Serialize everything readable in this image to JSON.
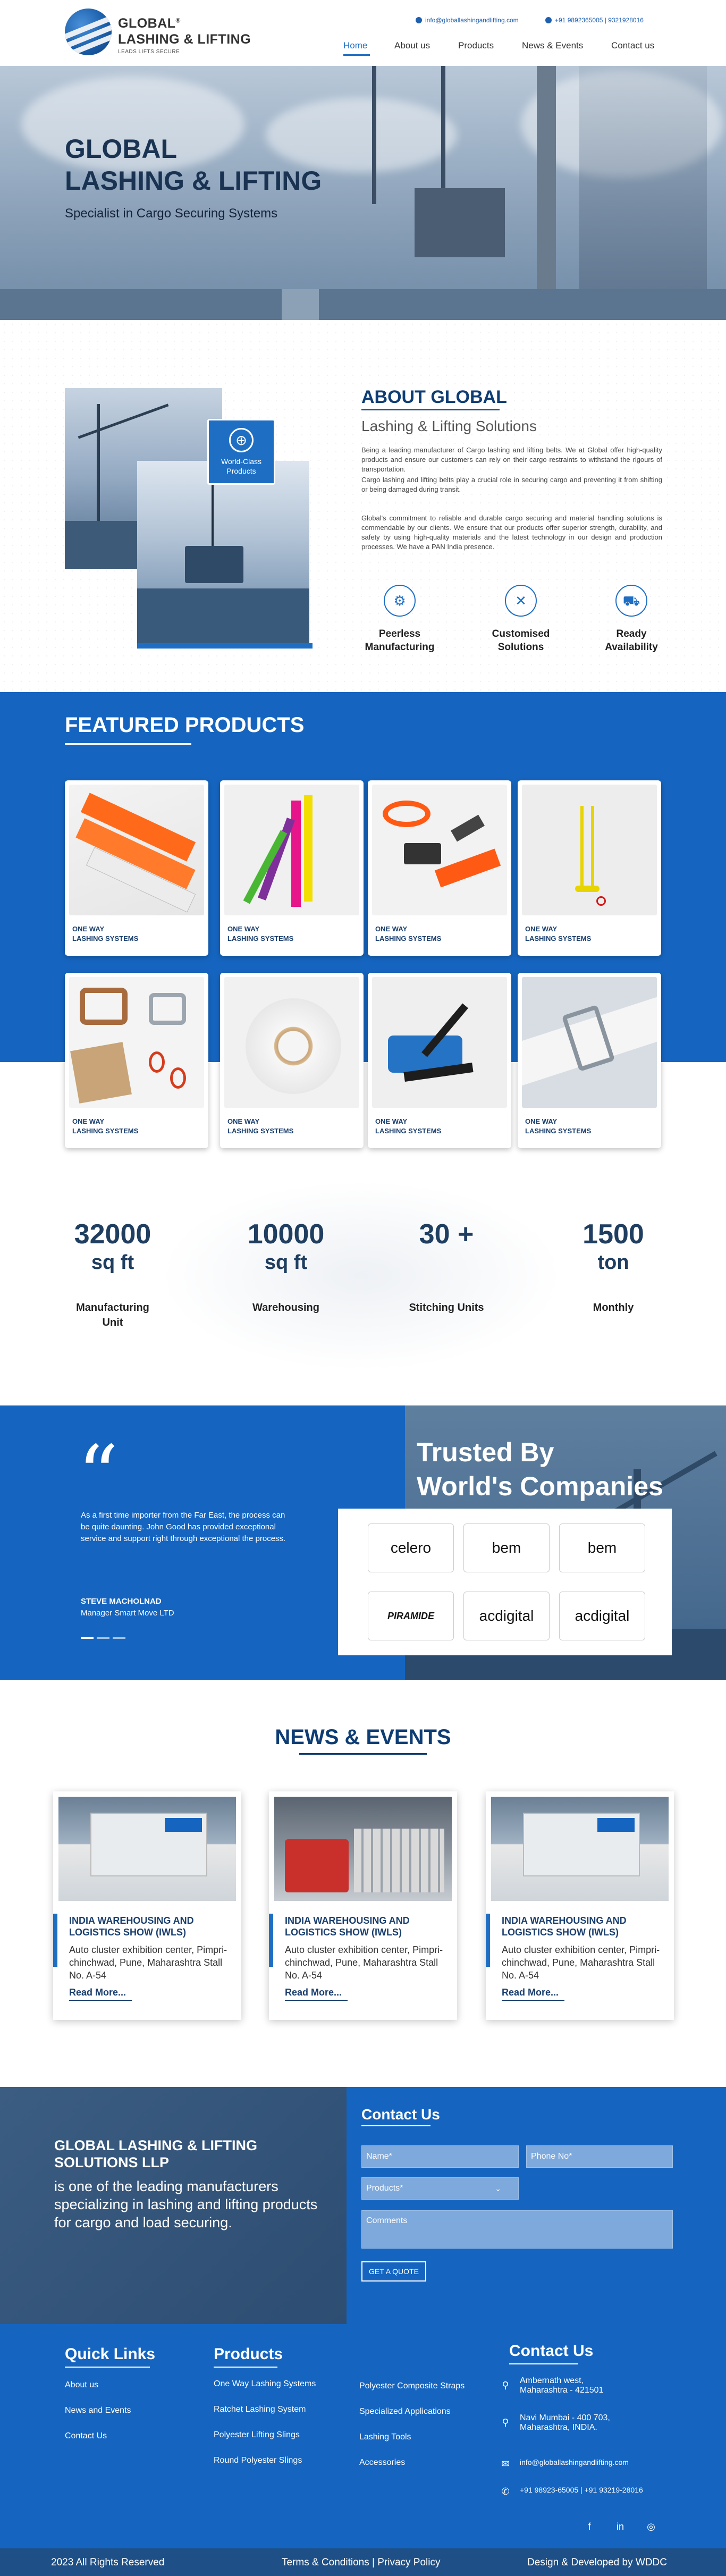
{
  "header": {
    "logo_line1": "GLOBAL",
    "logo_registered": "®",
    "logo_line2": "LASHING & LIFTING",
    "logo_tagline": "LEADS LIFTS SECURE",
    "email": "info@globallashingandlifting.com",
    "phones": "+91 9892365005 | 9321928016",
    "nav": [
      "Home",
      "About us",
      "Products",
      "News & Events",
      "Contact us"
    ],
    "active_nav": "Home"
  },
  "hero": {
    "title_line1": "GLOBAL",
    "title_line2": "LASHING & LIFTING",
    "subtitle": "Specialist in Cargo Securing Systems"
  },
  "about": {
    "badge": "World-Class Products",
    "heading": "ABOUT GLOBAL",
    "subheading": "Lashing & Lifting Solutions",
    "para1": "Being a leading manufacturer of Cargo lashing and lifting belts. We at Global offer high-quality products and ensure our customers can rely on their cargo restraints to withstand the rigours of transportation.",
    "para2": "Cargo lashing and lifting belts play a crucial role in securing cargo and preventing it from shifting or being damaged during transit.",
    "para3": "Global's commitment to reliable and durable cargo securing and material handling solutions is commendable by our clients. We ensure that our products offer superior strength, durability, and safety by using high-quality materials and the latest technology in our design and production processes. We have a PAN India presence.",
    "features": [
      {
        "icon": "gear-icon",
        "label_line1": "Peerless",
        "label_line2": "Manufacturing"
      },
      {
        "icon": "tools-icon",
        "label_line1": "Customised",
        "label_line2": "Solutions"
      },
      {
        "icon": "truck-icon",
        "label_line1": "Ready",
        "label_line2": "Availability"
      }
    ]
  },
  "products": {
    "heading": "FEATURED PRODUCTS",
    "items": [
      {
        "line1": "ONE WAY",
        "line2": "LASHING SYSTEMS"
      },
      {
        "line1": "ONE WAY",
        "line2": "LASHING SYSTEMS"
      },
      {
        "line1": "ONE WAY",
        "line2": "LASHING SYSTEMS"
      },
      {
        "line1": "ONE WAY",
        "line2": "LASHING SYSTEMS"
      },
      {
        "line1": "ONE WAY",
        "line2": "LASHING SYSTEMS"
      },
      {
        "line1": "ONE WAY",
        "line2": "LASHING SYSTEMS"
      },
      {
        "line1": "ONE WAY",
        "line2": "LASHING SYSTEMS"
      },
      {
        "line1": "ONE WAY",
        "line2": "LASHING SYSTEMS"
      }
    ]
  },
  "stats": [
    {
      "num": "32000",
      "unit": "sq ft",
      "label_line1": "Manufacturing",
      "label_line2": "Unit"
    },
    {
      "num": "10000",
      "unit": "sq ft",
      "label_line1": "Warehousing",
      "label_line2": ""
    },
    {
      "num": "30 +",
      "unit": "",
      "label_line1": "Stitching Units",
      "label_line2": ""
    },
    {
      "num": "1500",
      "unit": "ton",
      "label_line1": "Monthly",
      "label_line2": ""
    }
  ],
  "testimonial": {
    "quote": "As a first time importer from the Far East, the process can be quite daunting. John Good has provided exceptional service and support right through exceptional the process.",
    "name": "STEVE MACHOLNAD",
    "role": "Manager Smart Move LTD",
    "trusted_line1": "Trusted By",
    "trusted_line2": "World's Companies",
    "brands": [
      "celero",
      "bem",
      "bem",
      "PIRAMIDE",
      "acdigital",
      "acdigital"
    ]
  },
  "news": {
    "heading": "NEWS & EVENTS",
    "items": [
      {
        "title": "INDIA WAREHOUSING AND LOGISTICS SHOW (IWLS)",
        "body": "Auto cluster exhibition center, Pimpri- chinchwad, Pune, Maharashtra Stall No. A-54",
        "more": "Read More..."
      },
      {
        "title": "INDIA WAREHOUSING AND LOGISTICS SHOW (IWLS)",
        "body": "Auto cluster exhibition center, Pimpri- chinchwad, Pune, Maharashtra Stall No. A-54",
        "more": "Read More..."
      },
      {
        "title": "INDIA WAREHOUSING AND LOGISTICS SHOW (IWLS)",
        "body": "Auto cluster exhibition center, Pimpri- chinchwad, Pune, Maharashtra Stall No. A-54",
        "more": "Read More..."
      }
    ]
  },
  "contact": {
    "company": "GLOBAL LASHING & LIFTING SOLUTIONS LLP",
    "desc": "is one of the leading manufacturers specializing in lashing and lifting products for cargo and load securing.",
    "heading": "Contact Us",
    "name_ph": "Name*",
    "phone_ph": "Phone No*",
    "products_ph": "Products*",
    "comments_ph": "Comments",
    "button": "GET A QUOTE"
  },
  "footer": {
    "quick_heading": "Quick Links",
    "quick_links": [
      "About us",
      "News and Events",
      "Contact Us"
    ],
    "products_heading": "Products",
    "products_col1": [
      "One Way Lashing Systems",
      "Ratchet Lashing System",
      "Polyester Lifting Slings",
      "Round Polyester Slings"
    ],
    "products_col2": [
      "Polyester Composite Straps",
      "Specialized Applications",
      "Lashing Tools",
      "Accessories"
    ],
    "contact_heading": "Contact Us",
    "address1_line1": "Ambernath west,",
    "address1_line2": "Maharashtra - 421501",
    "address2_line1": "Navi Mumbai - 400 703,",
    "address2_line2": "Maharashtra, INDIA.",
    "email": "info@globallashingandlifting.com",
    "phones": "+91 98923-65005 | +91 93219-28016",
    "social": [
      "f",
      "in",
      "◎"
    ],
    "copyright": "2023 All Rights Reserved",
    "legal_links": "Terms & Conditions | Privacy Policy",
    "credit": "Design & Developed by WDDC"
  },
  "colors": {
    "brand_blue": "#1565c0",
    "dark_navy": "#0e3d74"
  }
}
